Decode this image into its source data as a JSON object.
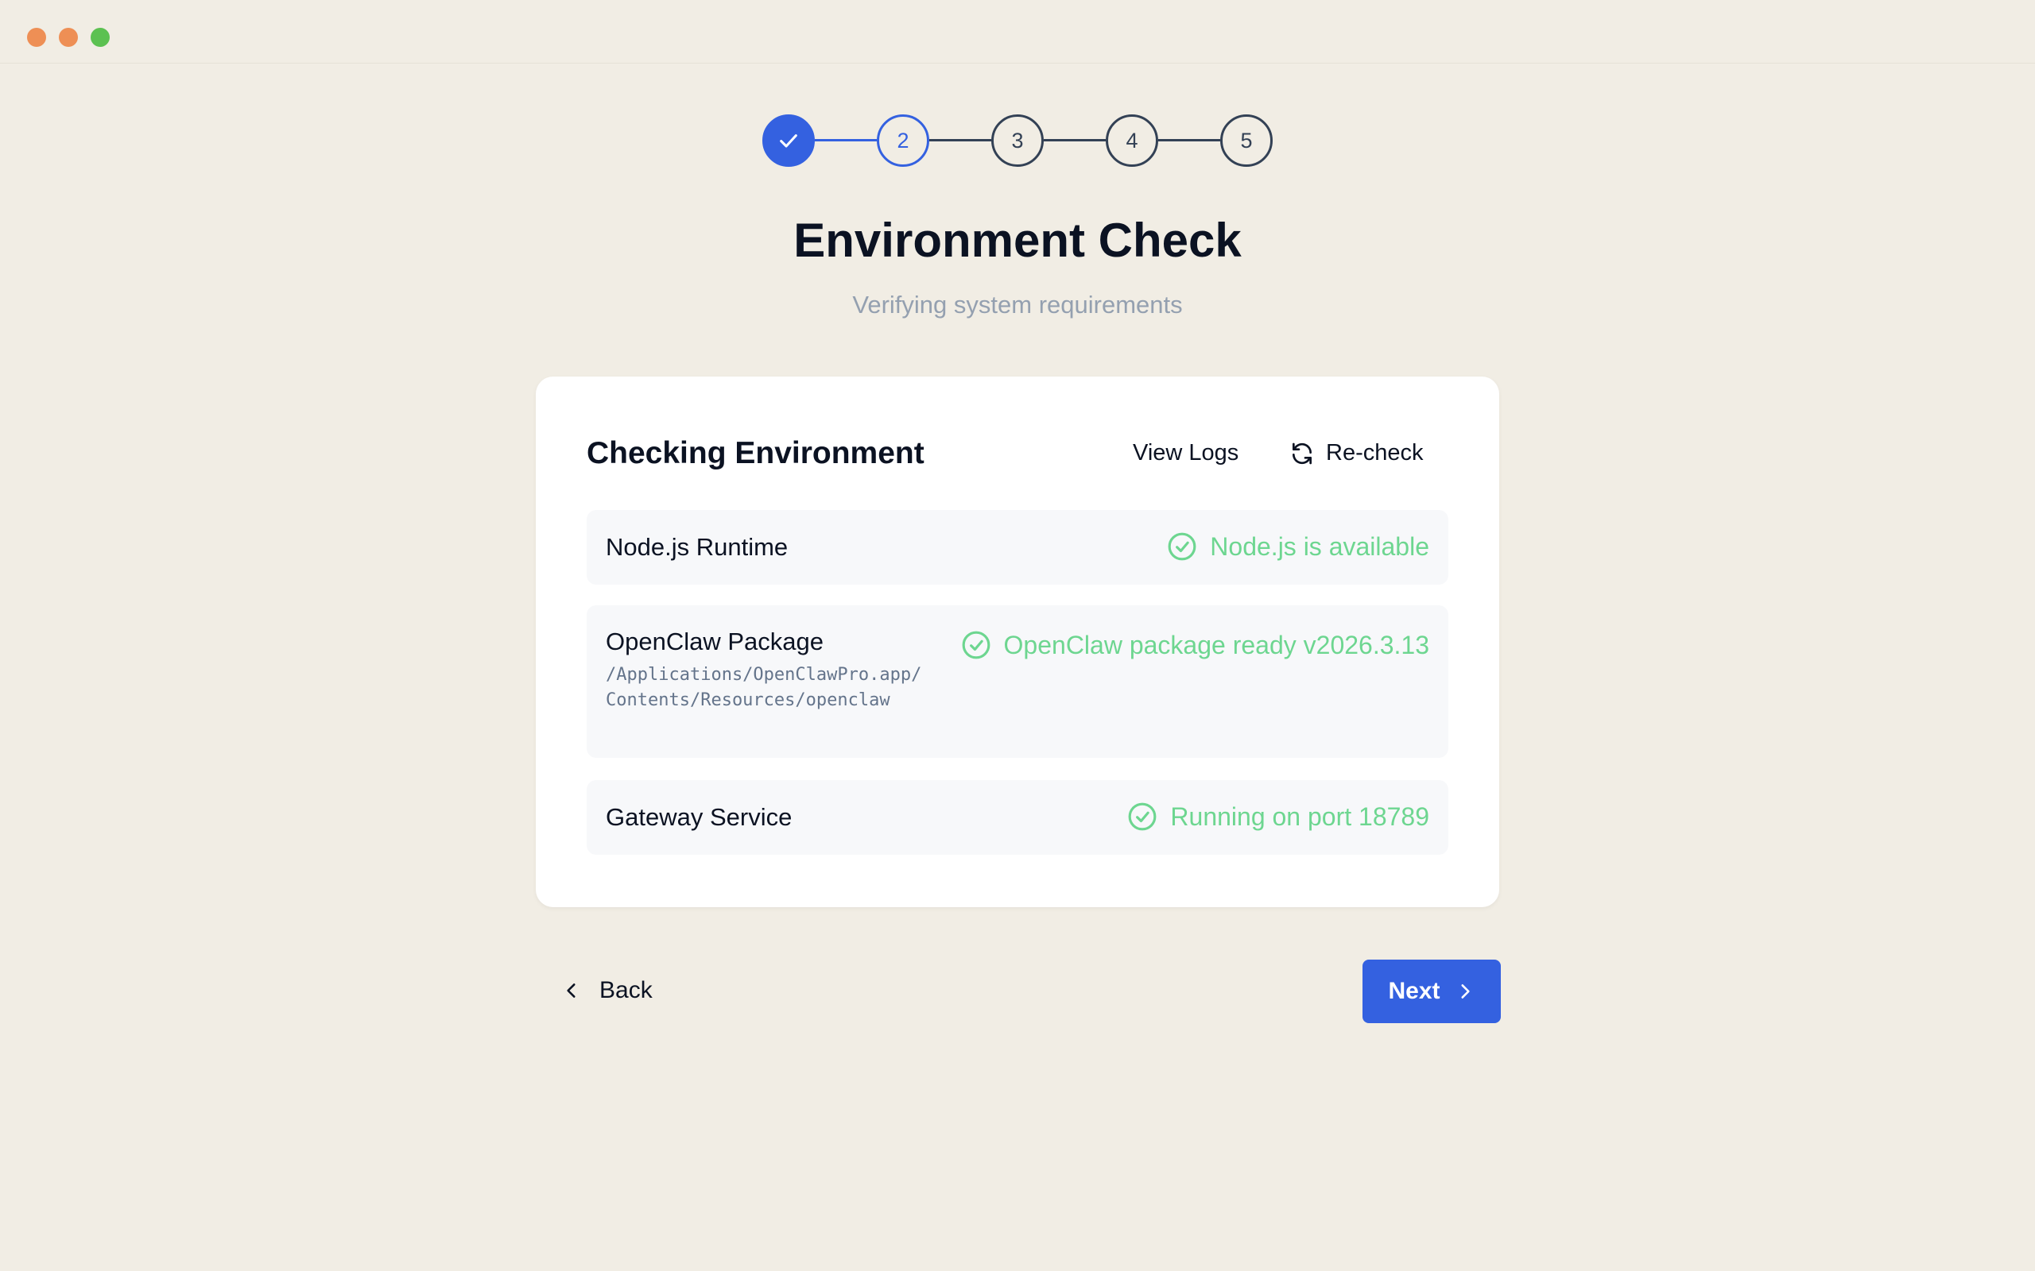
{
  "window": {
    "controls": [
      "close",
      "minimize",
      "maximize"
    ],
    "colors": {
      "close": "#ee8f55",
      "minimize": "#ee8f55",
      "maximize": "#5cc151"
    }
  },
  "stepper": {
    "steps": [
      {
        "label": "",
        "state": "done",
        "icon": "check-icon"
      },
      {
        "label": "2",
        "state": "active"
      },
      {
        "label": "3",
        "state": "pending"
      },
      {
        "label": "4",
        "state": "pending"
      },
      {
        "label": "5",
        "state": "pending"
      }
    ],
    "accent": "#3461e0"
  },
  "header": {
    "title": "Environment Check",
    "subtitle": "Verifying system requirements"
  },
  "card": {
    "title": "Checking Environment",
    "view_logs_label": "View Logs",
    "recheck_label": "Re-check",
    "checks": [
      {
        "name": "Node.js Runtime",
        "status": "Node.js is available",
        "state": "ok"
      },
      {
        "name": "OpenClaw Package",
        "path": "/Applications/OpenClawPro.app/Contents/Resources/openclaw",
        "status": "OpenClaw package ready v2026.3.13",
        "state": "ok"
      },
      {
        "name": "Gateway Service",
        "status": "Running on port 18789",
        "state": "ok"
      }
    ],
    "ok_color": "#6dd690"
  },
  "footer": {
    "back_label": "Back",
    "next_label": "Next"
  }
}
